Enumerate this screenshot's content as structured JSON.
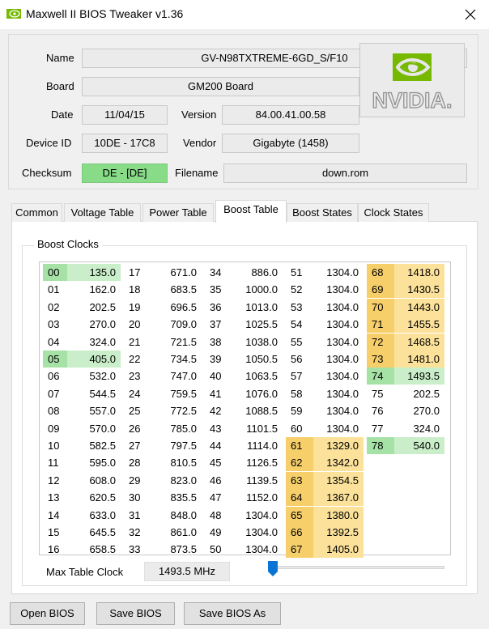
{
  "window": {
    "title": "Maxwell II BIOS Tweaker v1.36",
    "app_icon": "nvidia-eye-icon",
    "close_icon": "close-icon"
  },
  "info": {
    "name_label": "Name",
    "name_value": "GV-N98TXTREME-6GD_S/F10",
    "board_label": "Board",
    "board_value": "GM200 Board",
    "date_label": "Date",
    "date_value": "11/04/15",
    "version_label": "Version",
    "version_value": "84.00.41.00.58",
    "device_label": "Device ID",
    "device_value": "10DE - 17C8",
    "vendor_label": "Vendor",
    "vendor_value": "Gigabyte (1458)",
    "checksum_label": "Checksum",
    "checksum_value": "DE - [DE]",
    "filename_label": "Filename",
    "filename_value": "down.rom",
    "logo_text": "NVIDIA."
  },
  "tabs": [
    "Common",
    "Voltage Table",
    "Power Table",
    "Boost Table",
    "Boost States",
    "Clock States"
  ],
  "active_tab": "Boost Table",
  "boost": {
    "group_title": "Boost Clocks",
    "columns": [
      [
        [
          "00",
          "135.0",
          "g"
        ],
        [
          "01",
          "162.0",
          ""
        ],
        [
          "02",
          "202.5",
          ""
        ],
        [
          "03",
          "270.0",
          ""
        ],
        [
          "04",
          "324.0",
          ""
        ],
        [
          "05",
          "405.0",
          "g"
        ],
        [
          "06",
          "532.0",
          ""
        ],
        [
          "07",
          "544.5",
          ""
        ],
        [
          "08",
          "557.0",
          ""
        ],
        [
          "09",
          "570.0",
          ""
        ],
        [
          "10",
          "582.5",
          ""
        ],
        [
          "11",
          "595.0",
          ""
        ],
        [
          "12",
          "608.0",
          ""
        ],
        [
          "13",
          "620.5",
          ""
        ],
        [
          "14",
          "633.0",
          ""
        ],
        [
          "15",
          "645.5",
          ""
        ],
        [
          "16",
          "658.5",
          ""
        ]
      ],
      [
        [
          "17",
          "671.0",
          ""
        ],
        [
          "18",
          "683.5",
          ""
        ],
        [
          "19",
          "696.5",
          ""
        ],
        [
          "20",
          "709.0",
          ""
        ],
        [
          "21",
          "721.5",
          ""
        ],
        [
          "22",
          "734.5",
          ""
        ],
        [
          "23",
          "747.0",
          ""
        ],
        [
          "24",
          "759.5",
          ""
        ],
        [
          "25",
          "772.5",
          ""
        ],
        [
          "26",
          "785.0",
          ""
        ],
        [
          "27",
          "797.5",
          ""
        ],
        [
          "28",
          "810.5",
          ""
        ],
        [
          "29",
          "823.0",
          ""
        ],
        [
          "30",
          "835.5",
          ""
        ],
        [
          "31",
          "848.0",
          ""
        ],
        [
          "32",
          "861.0",
          ""
        ],
        [
          "33",
          "873.5",
          ""
        ]
      ],
      [
        [
          "34",
          "886.0",
          ""
        ],
        [
          "35",
          "1000.0",
          ""
        ],
        [
          "36",
          "1013.0",
          ""
        ],
        [
          "37",
          "1025.5",
          ""
        ],
        [
          "38",
          "1038.0",
          ""
        ],
        [
          "39",
          "1050.5",
          ""
        ],
        [
          "40",
          "1063.5",
          ""
        ],
        [
          "41",
          "1076.0",
          ""
        ],
        [
          "42",
          "1088.5",
          ""
        ],
        [
          "43",
          "1101.5",
          ""
        ],
        [
          "44",
          "1114.0",
          ""
        ],
        [
          "45",
          "1126.5",
          ""
        ],
        [
          "46",
          "1139.5",
          ""
        ],
        [
          "47",
          "1152.0",
          ""
        ],
        [
          "48",
          "1304.0",
          ""
        ],
        [
          "49",
          "1304.0",
          ""
        ],
        [
          "50",
          "1304.0",
          ""
        ]
      ],
      [
        [
          "51",
          "1304.0",
          ""
        ],
        [
          "52",
          "1304.0",
          ""
        ],
        [
          "53",
          "1304.0",
          ""
        ],
        [
          "54",
          "1304.0",
          ""
        ],
        [
          "55",
          "1304.0",
          ""
        ],
        [
          "56",
          "1304.0",
          ""
        ],
        [
          "57",
          "1304.0",
          ""
        ],
        [
          "58",
          "1304.0",
          ""
        ],
        [
          "59",
          "1304.0",
          ""
        ],
        [
          "60",
          "1304.0",
          ""
        ],
        [
          "61",
          "1329.0",
          "y"
        ],
        [
          "62",
          "1342.0",
          "y"
        ],
        [
          "63",
          "1354.5",
          "y"
        ],
        [
          "64",
          "1367.0",
          "y"
        ],
        [
          "65",
          "1380.0",
          "y"
        ],
        [
          "66",
          "1392.5",
          "y"
        ],
        [
          "67",
          "1405.0",
          "y"
        ]
      ],
      [
        [
          "68",
          "1418.0",
          "y"
        ],
        [
          "69",
          "1430.5",
          "y"
        ],
        [
          "70",
          "1443.0",
          "y"
        ],
        [
          "71",
          "1455.5",
          "y"
        ],
        [
          "72",
          "1468.5",
          "y"
        ],
        [
          "73",
          "1481.0",
          "y"
        ],
        [
          "74",
          "1493.5",
          "g"
        ],
        [
          "75",
          "202.5",
          ""
        ],
        [
          "76",
          "270.0",
          ""
        ],
        [
          "77",
          "324.0",
          ""
        ],
        [
          "78",
          "540.0",
          "g"
        ]
      ]
    ],
    "max_label": "Max Table Clock",
    "max_value": "1493.5 MHz"
  },
  "buttons": {
    "open": "Open BIOS",
    "save": "Save BIOS",
    "save_as": "Save BIOS As"
  },
  "colors": {
    "green_cell": "#c9eec9",
    "yellow_cell": "#fbe19a",
    "checksum_ok": "#88dc88",
    "nvidia_green": "#76b900"
  }
}
